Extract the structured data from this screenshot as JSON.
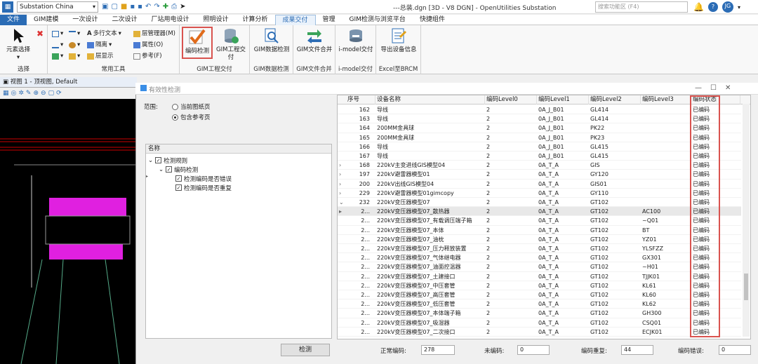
{
  "window": {
    "workspace": "Substation China",
    "title": "---总装.dgn [3D - V8 DGN] - OpenUtilities Substation",
    "search_placeholder": "搜索功能区 (F4)",
    "user_initials": "JG"
  },
  "tabs": [
    "文件",
    "GIM建模",
    "一次设计",
    "二次设计",
    "厂站用电设计",
    "照明设计",
    "计算分析",
    "成果交付",
    "管理",
    "GIM检测与浏览平台",
    "快捷组件"
  ],
  "ribbon": {
    "select": {
      "button": "元素选择",
      "group": "选择"
    },
    "common": {
      "items": [
        "多行文本",
        "层管理器(M)",
        "隔离",
        "属性(O)",
        "层显示",
        "参考(F)"
      ],
      "group": "常用工具"
    },
    "gim": {
      "check": "编码检测",
      "deliver": "GIM工程交付",
      "group": "GIM工程交付"
    },
    "gimdata": {
      "button": "GIM数据检测",
      "group": "GIM数据检测"
    },
    "merge": {
      "button": "GIM文件合并",
      "group": "GIM文件合并"
    },
    "imodel": {
      "button": "i-model交付",
      "group": "i-model交付"
    },
    "excel": {
      "button": "导出设备信息",
      "group": "Excel至BRCM"
    }
  },
  "view": {
    "title": "视图 1 - 顶视图, Default"
  },
  "dialog": {
    "title": "有效性检测",
    "scope_label": "范围:",
    "radio1": "当前图纸页",
    "radio2": "包含参考页",
    "tree_header": "名称",
    "tree": [
      "检测规则",
      "编码检测",
      "检测编码是否错误",
      "检测编码是否重复"
    ],
    "check_button": "检测",
    "columns": [
      "序号",
      "设备名称",
      "编码Level0",
      "编码Level1",
      "编码Level2",
      "编码Level3",
      "编码状态"
    ],
    "rows": [
      [
        "162",
        "导线",
        "2",
        "0A_J_B01",
        "GL414",
        "",
        "已编码"
      ],
      [
        "163",
        "导线",
        "2",
        "0A_J_B01",
        "GL414",
        "",
        "已编码"
      ],
      [
        "164",
        "200MM金具球",
        "2",
        "0A_J_B01",
        "PK22",
        "",
        "已编码"
      ],
      [
        "165",
        "200MM金具球",
        "2",
        "0A_J_B01",
        "PK23",
        "",
        "已编码"
      ],
      [
        "166",
        "导线",
        "2",
        "0A_J_B01",
        "GL415",
        "",
        "已编码"
      ],
      [
        "167",
        "导线",
        "2",
        "0A_J_B01",
        "GL415",
        "",
        "已编码"
      ],
      [
        "168",
        "220kV主变进线GIS模型04",
        "2",
        "0A_T_A",
        "GIS",
        "",
        "已编码"
      ],
      [
        "197",
        "220kV避雷器模型01",
        "2",
        "0A_T_A",
        "GY120",
        "",
        "已编码"
      ],
      [
        "200",
        "220kV出线GIS模型04",
        "2",
        "0A_T_A",
        "GIS01",
        "",
        "已编码"
      ],
      [
        "229",
        "220kV避雷器模型01gimcopy",
        "2",
        "0A_T_A",
        "GY110",
        "",
        "已编码"
      ],
      [
        "232",
        "220kV变压器模型07",
        "2",
        "0A_T_A",
        "GT102",
        "",
        "已编码"
      ],
      [
        "2...",
        "220kV变压器模型07_散热器",
        "2",
        "0A_T_A",
        "GT102",
        "AC100",
        "已编码"
      ],
      [
        "2...",
        "220kV变压器模型07_有载调压端子箱",
        "2",
        "0A_T_A",
        "GT102",
        "~Q01",
        "已编码"
      ],
      [
        "2...",
        "220kV变压器模型07_本体",
        "2",
        "0A_T_A",
        "GT102",
        "BT",
        "已编码"
      ],
      [
        "2...",
        "220kV变压器模型07_油枕",
        "2",
        "0A_T_A",
        "GT102",
        "YZ01",
        "已编码"
      ],
      [
        "2...",
        "220kV变压器模型07_压力释放装置",
        "2",
        "0A_T_A",
        "GT102",
        "YLSFZZ",
        "已编码"
      ],
      [
        "2...",
        "220kV变压器模型07_气体继电器",
        "2",
        "0A_T_A",
        "GT102",
        "GX301",
        "已编码"
      ],
      [
        "2...",
        "220kV变压器模型07_油面控温器",
        "2",
        "0A_T_A",
        "GT102",
        "~H01",
        "已编码"
      ],
      [
        "2...",
        "220kV变压器模型07_土建接口",
        "2",
        "0A_T_A",
        "GT102",
        "TJJK01",
        "已编码"
      ],
      [
        "2...",
        "220kV变压器模型07_中压套管",
        "2",
        "0A_T_A",
        "GT102",
        "KL61",
        "已编码"
      ],
      [
        "2...",
        "220kV变压器模型07_高压套管",
        "2",
        "0A_T_A",
        "GT102",
        "KL60",
        "已编码"
      ],
      [
        "2...",
        "220kV变压器模型07_低压套管",
        "2",
        "0A_T_A",
        "GT102",
        "KL62",
        "已编码"
      ],
      [
        "2...",
        "220kV变压器模型07_本体端子箱",
        "2",
        "0A_T_A",
        "GT102",
        "GH300",
        "已编码"
      ],
      [
        "2...",
        "220kV变压器模型07_吸湿器",
        "2",
        "0A_T_A",
        "GT102",
        "CSQ01",
        "已编码"
      ],
      [
        "2...",
        "220kV变压器模型07_二次接口",
        "2",
        "0A_T_A",
        "GT102",
        "ECJK01",
        "已编码"
      ]
    ],
    "stats": [
      {
        "label": "正常编码:",
        "value": "278"
      },
      {
        "label": "未编码:",
        "value": "0"
      },
      {
        "label": "编码重复:",
        "value": "44"
      },
      {
        "label": "编码错误:",
        "value": "0"
      }
    ]
  }
}
